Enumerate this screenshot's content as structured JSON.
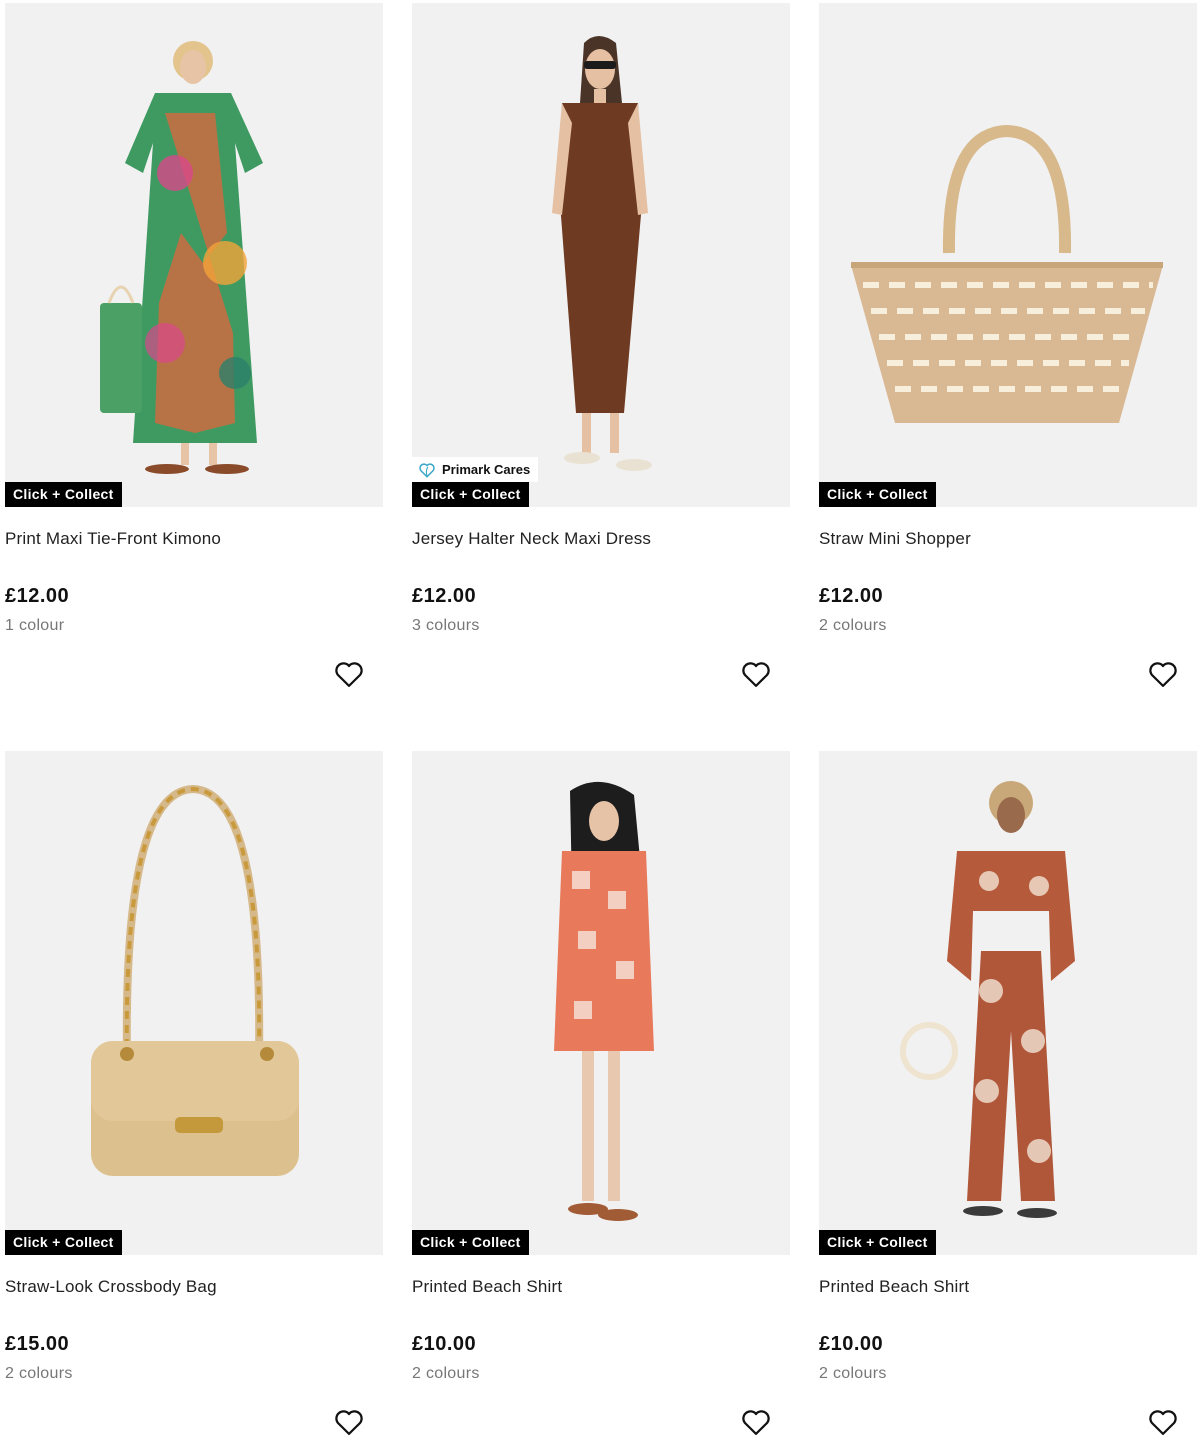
{
  "products": [
    {
      "title": "Print Maxi Tie-Front Kimono",
      "price": "£12.00",
      "colours": "1 colour",
      "badge": "Click + Collect",
      "image_icon": "kimono-image"
    },
    {
      "title": "Jersey Halter Neck Maxi Dress",
      "price": "£12.00",
      "colours": "3 colours",
      "badge": "Click + Collect",
      "extra_badge": "Primark Cares",
      "image_icon": "dress-image"
    },
    {
      "title": "Straw Mini Shopper",
      "price": "£12.00",
      "colours": "2 colours",
      "badge": "Click + Collect",
      "image_icon": "straw-shopper-image"
    },
    {
      "title": "Straw-Look Crossbody Bag",
      "price": "£15.00",
      "colours": "2 colours",
      "badge": "Click + Collect",
      "image_icon": "crossbody-bag-image"
    },
    {
      "title": "Printed Beach Shirt",
      "price": "£10.00",
      "colours": "2 colours",
      "badge": "Click + Collect",
      "image_icon": "beach-shirt-image"
    },
    {
      "title": "Printed Beach Shirt",
      "price": "£10.00",
      "colours": "2 colours",
      "badge": "Click + Collect",
      "image_icon": "beach-shirt-set-image"
    }
  ],
  "icons": {
    "wishlist": "heart-outline-icon",
    "cares": "heart-leaf-icon"
  },
  "colors": {
    "badge_bg": "#000000",
    "badge_text": "#ffffff",
    "image_bg": "#f1f1f1",
    "cares_icon": "#3aa6c8"
  }
}
